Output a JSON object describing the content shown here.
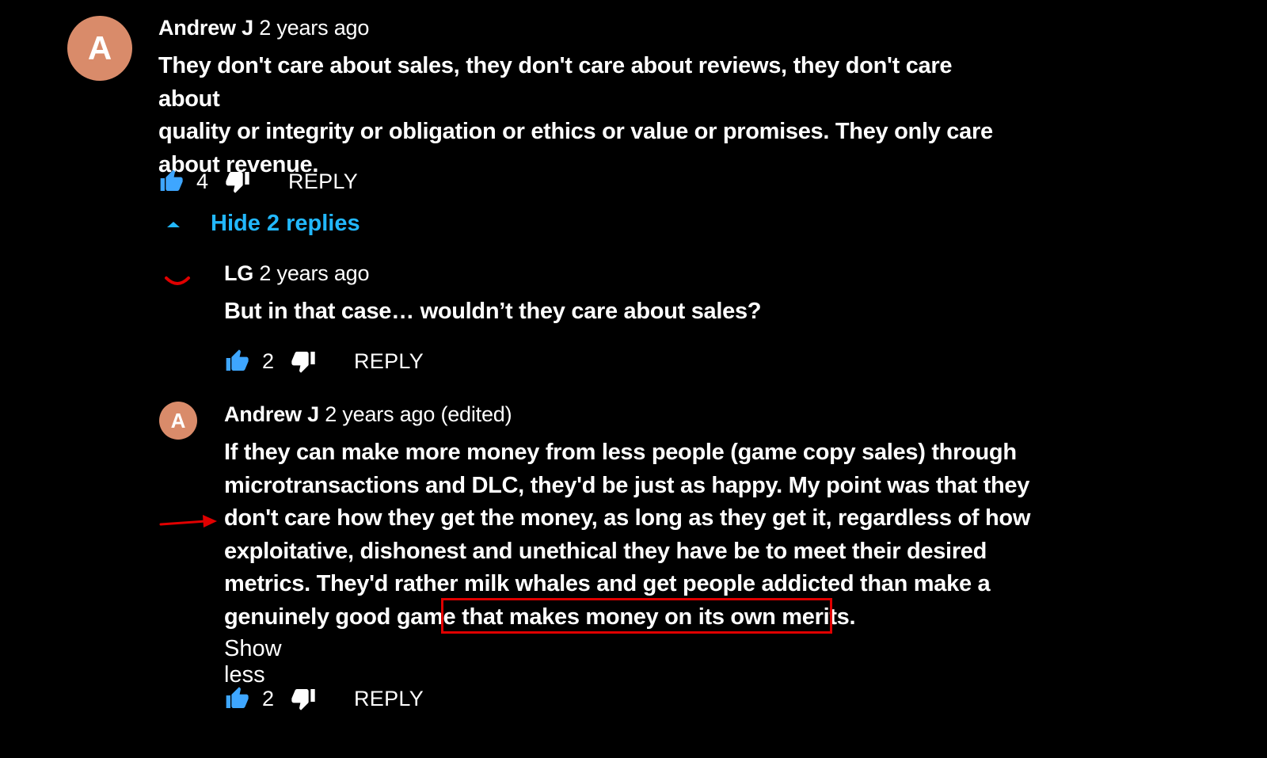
{
  "comments": [
    {
      "author": "Andrew J",
      "time": "2 years ago",
      "avatar_letter": "A",
      "avatar_color": "#d98b6a",
      "text_lines": [
        "They don't care about sales, they don't care about reviews, they don't care about",
        "quality or integrity or obligation or ethics or value or promises. They only care",
        "about revenue."
      ],
      "likes": "4",
      "reply_label": "REPLY"
    }
  ],
  "replies_toggle": {
    "label": "Hide 2 replies",
    "color": "#22b8ff"
  },
  "replies": [
    {
      "author": "LG",
      "time": "2 years ago",
      "avatar_icon": "red-smile-icon",
      "text_lines": [
        "But in that case… wouldn’t they care about sales?"
      ],
      "likes": "2",
      "reply_label": "REPLY"
    },
    {
      "author": "Andrew J",
      "time": "2 years ago (edited)",
      "avatar_letter": "A",
      "avatar_color": "#d98b6a",
      "text_lines": [
        "If they can make more money from less people (game copy sales) through",
        "microtransactions and DLC, they'd be just as happy. My point was that they",
        "don't care how they get the money, as long as they get it, regardless of how",
        "exploitative, dishonest and unethical they have be to meet their desired",
        "metrics. They'd rather milk whales and get people addicted than make a",
        "genuinely good game that makes money on its own merits."
      ],
      "show_less_label": "Show less",
      "likes": "2",
      "reply_label": "REPLY"
    }
  ],
  "annotations": {
    "highlight_color": "#e00000",
    "arrow_color": "#e00000"
  }
}
